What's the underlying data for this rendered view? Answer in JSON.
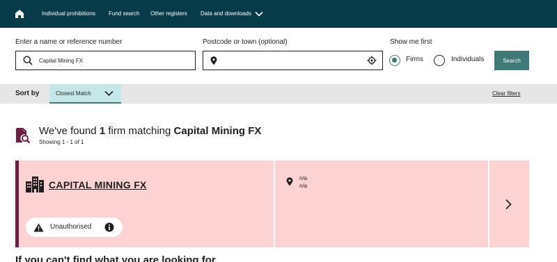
{
  "nav": {
    "home_icon": "home-icon",
    "links": [
      "Individual prohibitions",
      "Fund search",
      "Other registers",
      "Data and downloads"
    ],
    "colors": {
      "background": "#083b49",
      "text": "#ffffff"
    }
  },
  "search": {
    "name_label": "Enter a name or reference number",
    "name_value": "Capital Mining FX",
    "location_label": "Postcode or town (optional)",
    "location_value": "",
    "show_first_label": "Show me first",
    "options": [
      "Firms",
      "Individuals"
    ],
    "selected_option": "Firms",
    "button_label": "Search"
  },
  "sort": {
    "label": "Sort by",
    "selected": "Closest Match",
    "clear_filters": "Clear filters"
  },
  "results": {
    "heading_prefix": "We've found",
    "count": "1",
    "heading_middle": "firm matching",
    "query": "Capital Mining FX",
    "showing": "Showing 1 - 1 of 1"
  },
  "card": {
    "firm_name": "CAPITAL MINING FX",
    "status": "Unauthorised",
    "address_line1": "n/a",
    "address_line2": "n/a",
    "colors": {
      "background": "#fcd2d2",
      "accent": "#6e1f45"
    }
  },
  "footer_heading": "If you can't find what you are looking for",
  "accent_color": "#3f7a78"
}
